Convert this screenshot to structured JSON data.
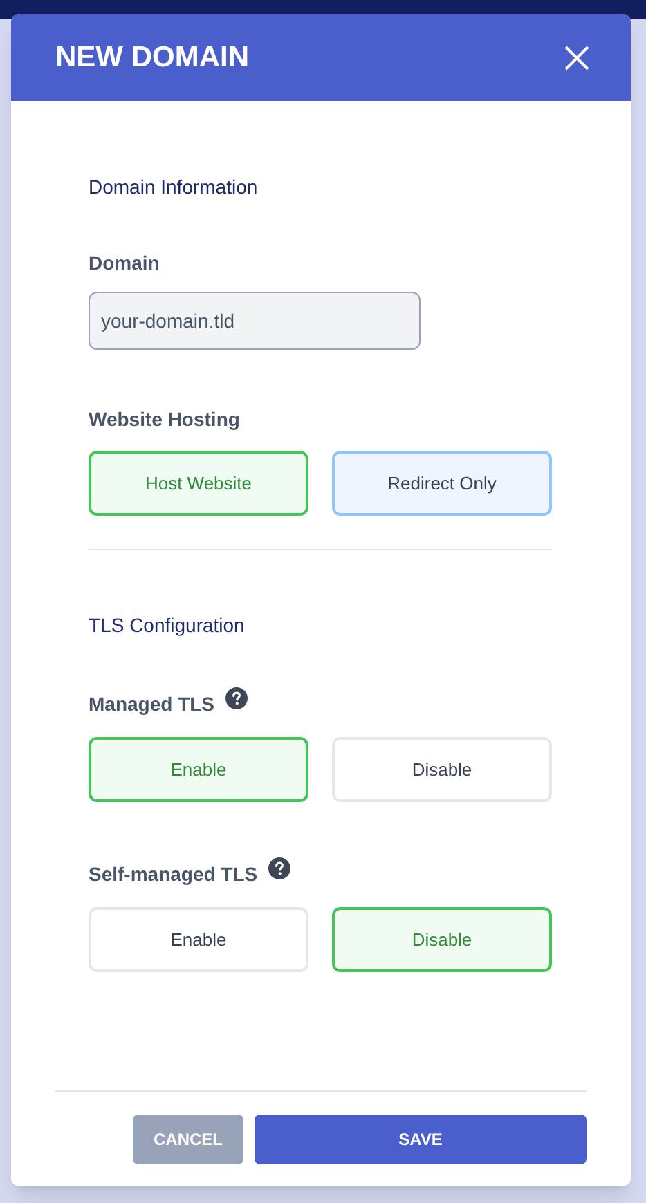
{
  "dialog": {
    "title": "NEW DOMAIN"
  },
  "sections": [
    {
      "heading": "Domain Information",
      "fields": [
        {
          "kind": "text",
          "label": "Domain",
          "value": "your-domain.tld"
        },
        {
          "kind": "choice",
          "label": "Website Hosting",
          "help": false,
          "options": [
            {
              "label": "Host Website",
              "selected": true,
              "hovered": false
            },
            {
              "label": "Redirect Only",
              "selected": false,
              "hovered": true
            }
          ]
        }
      ]
    },
    {
      "heading": "TLS Configuration",
      "fields": [
        {
          "kind": "choice",
          "label": "Managed TLS",
          "help": true,
          "options": [
            {
              "label": "Enable",
              "selected": true,
              "hovered": false
            },
            {
              "label": "Disable",
              "selected": false,
              "hovered": false
            }
          ]
        },
        {
          "kind": "choice",
          "label": "Self-managed TLS",
          "help": true,
          "options": [
            {
              "label": "Enable",
              "selected": false,
              "hovered": false
            },
            {
              "label": "Disable",
              "selected": true,
              "hovered": false
            }
          ]
        }
      ]
    }
  ],
  "buttons": [
    {
      "kind": "secondary",
      "label": "CANCEL"
    },
    {
      "kind": "primary",
      "label": "SAVE"
    }
  ]
}
